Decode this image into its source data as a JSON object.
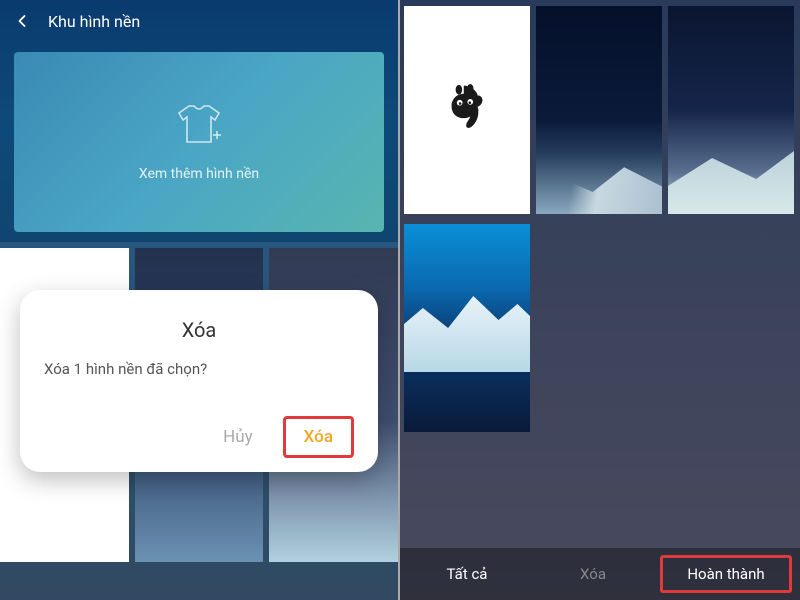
{
  "left": {
    "header_title": "Khu hình nền",
    "hero_label": "Xem thêm hình nền",
    "dialog": {
      "title": "Xóa",
      "message": "Xóa 1 hình nền đã chọn?",
      "cancel": "Hủy",
      "delete": "Xóa"
    }
  },
  "right": {
    "bar": {
      "all": "Tất cả",
      "delete": "Xóa",
      "done": "Hoàn thành"
    }
  },
  "icons": {
    "back": "back-icon",
    "shirt": "shirt-plus-icon",
    "uc": "uc-squirrel-icon"
  },
  "colors": {
    "accent_orange": "#f5a623",
    "highlight_red": "#e03a3a"
  }
}
